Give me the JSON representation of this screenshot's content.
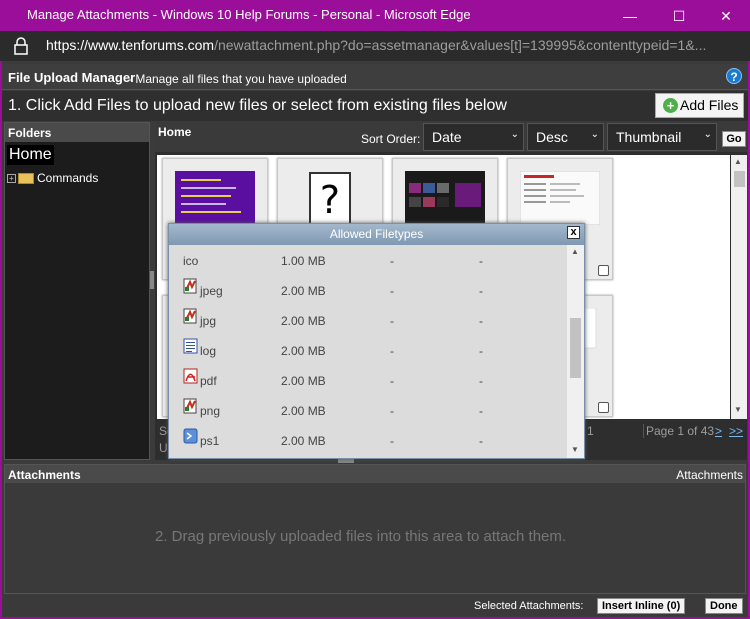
{
  "window": {
    "title": "Manage Attachments - Windows 10 Help Forums - Personal - Microsoft Edge",
    "minimize": "—",
    "maximize": "☐",
    "close": "✕"
  },
  "address": {
    "url_host": "https://www.tenforums.com",
    "url_path": "/newattachment.php?do=assetmanager&values[t]=139995&contenttypeid=1&..."
  },
  "manager": {
    "title": "File Upload Manager",
    "subtitle": "- Manage all files that you have uploaded",
    "help_icon": "?",
    "instruction": "1. Click Add Files to upload new files or select from existing files below",
    "add_files_label": "Add Files",
    "add_icon": "+"
  },
  "folders": {
    "header": "Folders",
    "items": [
      {
        "label": "Home"
      },
      {
        "label": "Commands"
      }
    ]
  },
  "main": {
    "header": "Home",
    "sort_label": "Sort Order:",
    "sort_field": "Date",
    "sort_dir": "Desc",
    "view": "Thumbnail",
    "go_label": "Go",
    "pager_frag_1": "Se",
    "pager_frag_2": "U",
    "page_num": "1",
    "page_text": "Page 1 of 43",
    "next": ">",
    "last": ">>"
  },
  "dialog": {
    "title": "Allowed Filetypes",
    "close": "x",
    "rows": [
      {
        "ext": "ico",
        "size": "1.00 MB",
        "d1": "-",
        "d2": "-",
        "icon": "none"
      },
      {
        "ext": "jpeg",
        "size": "2.00 MB",
        "d1": "-",
        "d2": "-",
        "icon": "image-file-icon"
      },
      {
        "ext": "jpg",
        "size": "2.00 MB",
        "d1": "-",
        "d2": "-",
        "icon": "image-file-icon"
      },
      {
        "ext": "log",
        "size": "2.00 MB",
        "d1": "-",
        "d2": "-",
        "icon": "text-file-icon"
      },
      {
        "ext": "pdf",
        "size": "2.00 MB",
        "d1": "-",
        "d2": "-",
        "icon": "pdf-file-icon"
      },
      {
        "ext": "png",
        "size": "2.00 MB",
        "d1": "-",
        "d2": "-",
        "icon": "image-file-icon"
      },
      {
        "ext": "ps1",
        "size": "2.00 MB",
        "d1": "-",
        "d2": "-",
        "icon": "script-file-icon"
      }
    ]
  },
  "attachments": {
    "header": "Attachments",
    "header_right": "Attachments",
    "message": "2. Drag previously uploaded files into this area to attach them."
  },
  "footer": {
    "selected_label": "Selected Attachments:",
    "insert_inline": "Insert Inline (0)",
    "done": "Done"
  }
}
